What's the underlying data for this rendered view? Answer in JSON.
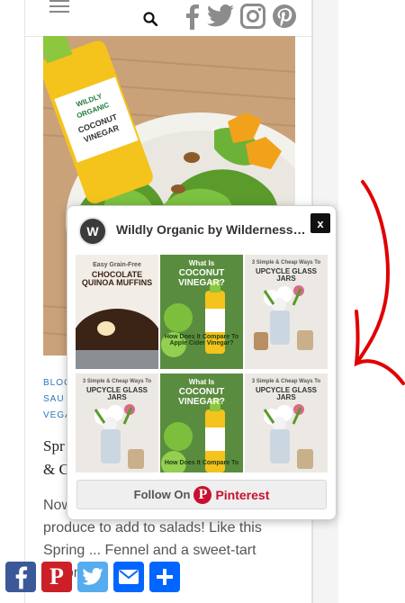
{
  "header": {
    "menu_icon": "hamburger-icon",
    "search_icon": "search-icon",
    "social_icons": [
      "facebook-icon",
      "twitter-icon",
      "instagram-icon",
      "pinterest-icon"
    ]
  },
  "hero": {
    "bottle_text_lines": [
      "WILDLY",
      "ORGANIC",
      "COCONUT",
      "VINEGAR"
    ]
  },
  "post": {
    "categories": [
      "BLOG",
      "SAU",
      "VEGA"
    ],
    "title_lines": [
      "Spr",
      "& C"
    ],
    "excerpt": "Now ... an exciting variety of fresh produce to add to salads! Like this Spring ... Fennel and a sweet-tart coconut..."
  },
  "popup": {
    "avatar_letter": "W",
    "profile_name": "Wildly Organic by Wilderness F...",
    "close_label": "x",
    "pins": [
      {
        "top": "Easy Grain-Free",
        "main": "CHOCOLATE QUINOA MUFFINS",
        "kind": "muffins"
      },
      {
        "top": "What Is",
        "main": "COCONUT VINEGAR?",
        "bottom": "How Does It Compare To Apple Cider Vinegar?",
        "kind": "vinegar"
      },
      {
        "top": "3 Simple & Cheap Ways To",
        "main": "UPCYCLE GLASS JARS",
        "kind": "jars"
      },
      {
        "top": "3 Simple & Cheap Ways To",
        "main": "UPCYCLE GLASS JARS",
        "kind": "jars"
      },
      {
        "top": "What Is",
        "main": "COCONUT VINEGAR?",
        "bottom": "How Does It Compare To",
        "kind": "vinegar"
      },
      {
        "top": "3 Simple & Cheap Ways To",
        "main": "UPCYCLE GLASS JARS",
        "kind": "jars"
      }
    ],
    "follow_label": "Follow On",
    "follow_brand": "Pinterest"
  },
  "share_bar": {
    "buttons": [
      {
        "name": "facebook",
        "color": "#3b5998"
      },
      {
        "name": "pinterest",
        "color": "#cb2027"
      },
      {
        "name": "twitter",
        "color": "#55acee"
      },
      {
        "name": "email",
        "color": "#0166ff"
      },
      {
        "name": "more",
        "color": "#0166ff"
      }
    ]
  },
  "colors": {
    "accent_link": "#2b78c2",
    "pinterest_red": "#c8102e",
    "arrow_red": "#e00000"
  }
}
